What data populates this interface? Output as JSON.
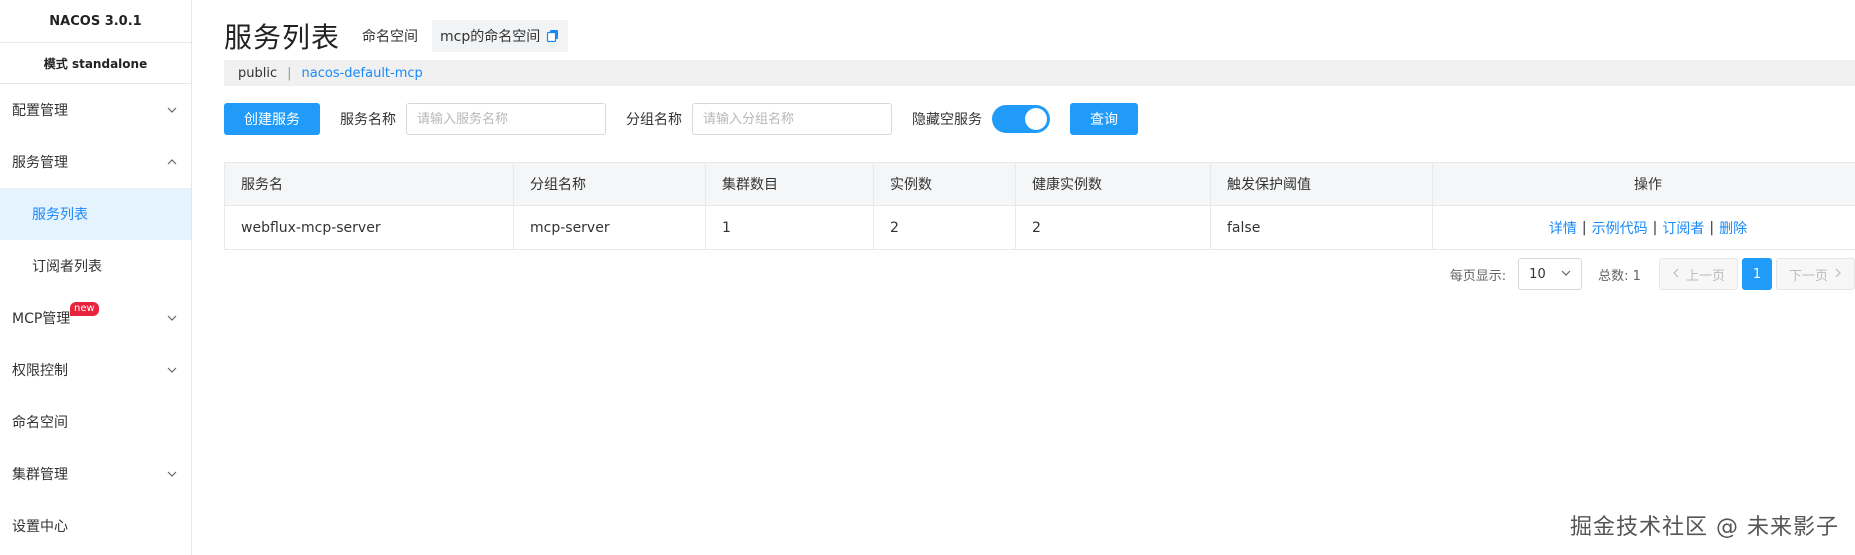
{
  "sidebar": {
    "brand": "NACOS 3.0.1",
    "mode": "模式 standalone",
    "items": [
      {
        "label": "配置管理"
      },
      {
        "label": "服务管理"
      },
      {
        "label": "服务列表"
      },
      {
        "label": "订阅者列表"
      },
      {
        "label": "MCP管理",
        "badge": "new"
      },
      {
        "label": "权限控制"
      },
      {
        "label": "命名空间"
      },
      {
        "label": "集群管理"
      },
      {
        "label": "设置中心"
      }
    ]
  },
  "header": {
    "title": "服务列表",
    "namespace_label": "命名空间",
    "namespace_value": "mcp的命名空间"
  },
  "namespace_bar": {
    "public": "public",
    "separator": "|",
    "current": "nacos-default-mcp"
  },
  "toolbar": {
    "create_label": "创建服务",
    "service_name_label": "服务名称",
    "service_name_placeholder": "请输入服务名称",
    "group_name_label": "分组名称",
    "group_name_placeholder": "请输入分组名称",
    "hide_empty_label": "隐藏空服务",
    "hide_empty_on": true,
    "query_label": "查询"
  },
  "table": {
    "columns": [
      "服务名",
      "分组名称",
      "集群数目",
      "实例数",
      "健康实例数",
      "触发保护阈值",
      "操作"
    ],
    "rows": [
      {
        "service": "webflux-mcp-server",
        "group": "mcp-server",
        "clusters": "1",
        "instances": "2",
        "healthy": "2",
        "protect": "false",
        "ops": [
          "详情",
          "示例代码",
          "订阅者",
          "删除"
        ]
      }
    ]
  },
  "pagination": {
    "per_page_label": "每页显示:",
    "per_page_value": "10",
    "total_label": "总数: 1",
    "prev_label": "上一页",
    "current_page": "1",
    "next_label": "下一页"
  },
  "watermark": "掘金技术社区 @ 未来影子",
  "colors": {
    "accent": "#209bfa",
    "link": "#1989fa",
    "active_bg": "#e5f3ff",
    "badge": "#e8233e"
  }
}
